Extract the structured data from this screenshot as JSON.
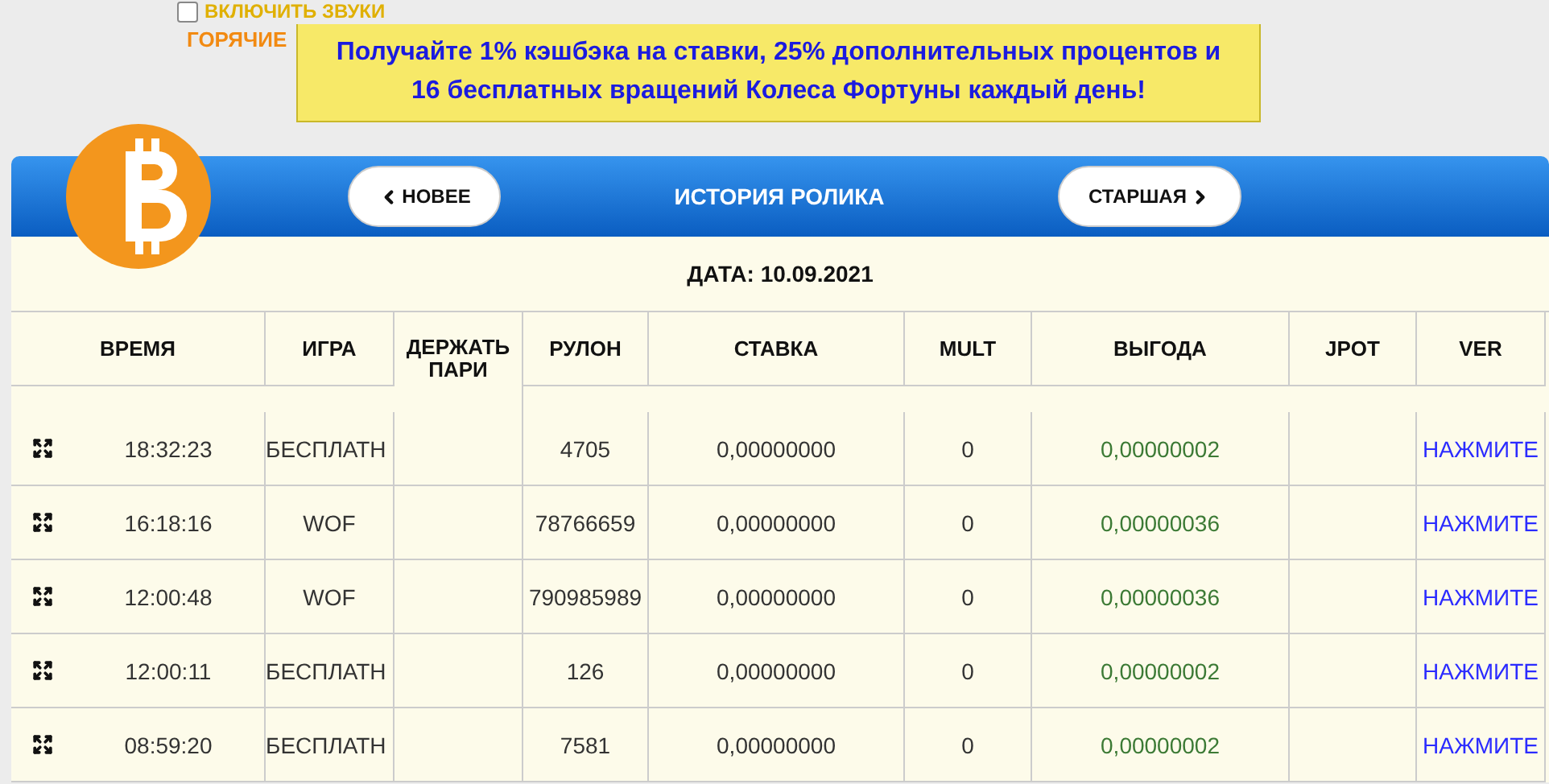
{
  "sound_toggle": {
    "label": "ВКЛЮЧИТЬ ЗВУКИ",
    "checked": false
  },
  "hotkeys_label": "ГОРЯЧИЕ",
  "promo_banner": {
    "lines": [
      "Получайте 1% кэшбэка на ставки, 25% дополнительных процентов и",
      "16 бесплатных вращений Колеса Фортуны каждый день!"
    ]
  },
  "panel": {
    "title": "ИСТОРИЯ РОЛИКА",
    "newer_button": "НОВЕЕ",
    "older_button": "СТАРШАЯ",
    "date": "ДАТА: 10.09.2021"
  },
  "table": {
    "columns": [
      "ВРЕМЯ",
      "ИГРА",
      "ДЕРЖАТЬ ПАРИ",
      "РУЛОН",
      "СТАВКА",
      "MULT",
      "ВЫГОДА",
      "JPOT",
      "VER"
    ],
    "rows": [
      {
        "time": "18:32:23",
        "game": "БЕСПЛАТН",
        "roll": "4705",
        "bet": "0,00000000",
        "mult": "0",
        "profit": "0,00000002",
        "link": "НАЖМИТЕ"
      },
      {
        "time": "16:18:16",
        "game": "WOF",
        "roll": "78766659",
        "bet": "0,00000000",
        "mult": "0",
        "profit": "0,00000036",
        "link": "НАЖМИТЕ"
      },
      {
        "time": "12:00:48",
        "game": "WOF",
        "roll": "790985989",
        "bet": "0,00000000",
        "mult": "0",
        "profit": "0,00000036",
        "link": "НАЖМИТЕ"
      },
      {
        "time": "12:00:11",
        "game": "БЕСПЛАТН",
        "roll": "126",
        "bet": "0,00000000",
        "mult": "0",
        "profit": "0,00000002",
        "link": "НАЖМИТЕ"
      },
      {
        "time": "08:59:20",
        "game": "БЕСПЛАТН",
        "roll": "7581",
        "bet": "0,00000000",
        "mult": "0",
        "profit": "0,00000002",
        "link": "НАЖМИТЕ"
      }
    ]
  }
}
